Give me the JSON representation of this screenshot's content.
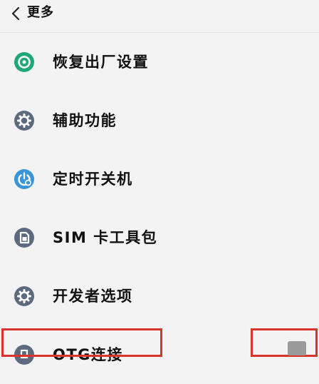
{
  "header": {
    "title": "更多",
    "back_icon": "chevron-left-icon"
  },
  "settings": {
    "items": [
      {
        "label": "恢复出厂设置",
        "icon": "factory-reset-icon",
        "color": "#1fa67a"
      },
      {
        "label": "辅助功能",
        "icon": "gear-icon",
        "color": "#5c6a80"
      },
      {
        "label": "定时开关机",
        "icon": "timer-power-icon",
        "color": "#3a95d8"
      },
      {
        "label": "SIM 卡工具包",
        "icon": "sim-card-icon",
        "color": "#5c6a80"
      },
      {
        "label": "开发者选项",
        "icon": "gear-icon",
        "color": "#5c6a80"
      },
      {
        "label": "OTG连接",
        "icon": "otg-icon",
        "color": "#5c6a80"
      }
    ]
  },
  "colors": {
    "highlight": "#d9342b",
    "background": "#f3f3f3"
  }
}
